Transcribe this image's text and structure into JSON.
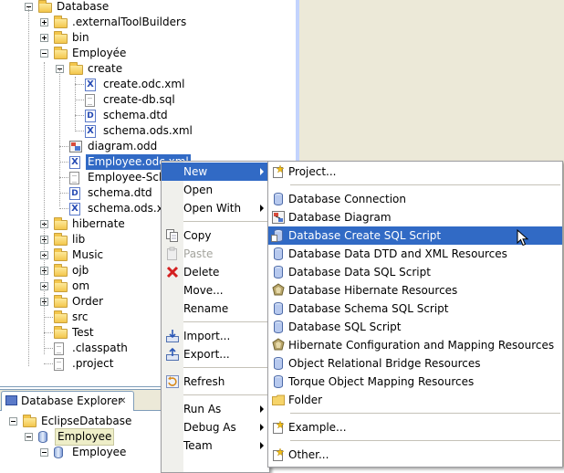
{
  "tree": [
    {
      "label": "Database",
      "type": "open-folder",
      "indent": 0,
      "expander": "minus"
    },
    {
      "label": ".externalToolBuilders",
      "type": "folder",
      "indent": 1,
      "expander": "plus"
    },
    {
      "label": "bin",
      "type": "folder",
      "indent": 1,
      "expander": "plus"
    },
    {
      "label": "Employée",
      "type": "open-folder",
      "indent": 1,
      "expander": "minus"
    },
    {
      "label": "create",
      "type": "open-folder",
      "indent": 2,
      "expander": "minus"
    },
    {
      "label": "create.odc.xml",
      "type": "xml",
      "indent": 3
    },
    {
      "label": "create-db.sql",
      "type": "file",
      "indent": 3
    },
    {
      "label": "schema.dtd",
      "type": "dtd",
      "indent": 3
    },
    {
      "label": "schema.ods.xml",
      "type": "xml",
      "indent": 3
    },
    {
      "label": "diagram.odd",
      "type": "diagram",
      "indent": 2
    },
    {
      "label": "Employee.odc.xml",
      "type": "xml",
      "indent": 2,
      "selected": true
    },
    {
      "label": "Employee-Schem",
      "type": "file",
      "indent": 2
    },
    {
      "label": "schema.dtd",
      "type": "dtd",
      "indent": 2
    },
    {
      "label": "schema.ods.xml",
      "type": "xml",
      "indent": 2
    },
    {
      "label": "hibernate",
      "type": "folder",
      "indent": 1,
      "expander": "plus"
    },
    {
      "label": "lib",
      "type": "folder",
      "indent": 1,
      "expander": "plus"
    },
    {
      "label": "Music",
      "type": "folder",
      "indent": 1,
      "expander": "plus"
    },
    {
      "label": "ojb",
      "type": "folder",
      "indent": 1,
      "expander": "plus"
    },
    {
      "label": "om",
      "type": "folder",
      "indent": 1,
      "expander": "plus"
    },
    {
      "label": "Order",
      "type": "folder",
      "indent": 1,
      "expander": "plus"
    },
    {
      "label": "src",
      "type": "folder",
      "indent": 1
    },
    {
      "label": "Test",
      "type": "folder",
      "indent": 1
    },
    {
      "label": ".classpath",
      "type": "file",
      "indent": 1
    },
    {
      "label": ".project",
      "type": "file",
      "indent": 1
    }
  ],
  "explorer": {
    "tab_label": "Database Explorer",
    "close_glyph": "✕",
    "items": [
      {
        "label": "EclipseDatabase",
        "type": "folder",
        "indent": 0,
        "expander": "minus"
      },
      {
        "label": "Employee",
        "type": "db",
        "indent": 1,
        "expander": "minus",
        "highlight": true
      },
      {
        "label": "Employee",
        "type": "db",
        "indent": 2,
        "expander": "minus"
      }
    ]
  },
  "context_menu": [
    {
      "label": "New",
      "submenu": true,
      "selected": true
    },
    {
      "label": "Open"
    },
    {
      "label": "Open With",
      "submenu": true
    },
    {
      "separator": true
    },
    {
      "label": "Copy",
      "icon": "copy-icon"
    },
    {
      "label": "Paste",
      "icon": "paste-icon",
      "disabled": true
    },
    {
      "label": "Delete",
      "icon": "delete-icon"
    },
    {
      "label": "Move..."
    },
    {
      "label": "Rename"
    },
    {
      "separator": true
    },
    {
      "label": "Import...",
      "icon": "import-icon"
    },
    {
      "label": "Export...",
      "icon": "export-icon"
    },
    {
      "separator": true
    },
    {
      "label": "Refresh",
      "icon": "refresh-icon"
    },
    {
      "separator": true
    },
    {
      "label": "Run As",
      "submenu": true
    },
    {
      "label": "Debug As",
      "submenu": true
    },
    {
      "label": "Team",
      "submenu": true
    }
  ],
  "new_submenu": [
    {
      "label": "Project...",
      "icon": "new-project-icon"
    },
    {
      "separator": true
    },
    {
      "label": "Database Connection",
      "icon": "db-icon"
    },
    {
      "label": "Database Diagram",
      "icon": "diagram-icon"
    },
    {
      "label": "Database Create SQL Script",
      "icon": "db-script-icon",
      "selected": true
    },
    {
      "label": "Database Data DTD and XML Resources",
      "icon": "db-icon"
    },
    {
      "label": "Database Data SQL Script",
      "icon": "db-icon"
    },
    {
      "label": "Database Hibernate Resources",
      "icon": "hibernate-icon"
    },
    {
      "label": "Database Schema SQL Script",
      "icon": "db-icon"
    },
    {
      "label": "Database SQL Script",
      "icon": "db-icon"
    },
    {
      "label": "Hibernate Configuration and Mapping Resources",
      "icon": "hibernate-icon"
    },
    {
      "label": "Object Relational Bridge Resources",
      "icon": "db-icon"
    },
    {
      "label": "Torque Object Mapping Resources",
      "icon": "db-icon"
    },
    {
      "label": "Folder",
      "icon": "folder-icon"
    },
    {
      "separator": true
    },
    {
      "label": "Example...",
      "icon": "new-example-icon"
    },
    {
      "separator": true
    },
    {
      "label": "Other...",
      "icon": "new-other-icon"
    }
  ],
  "colors": {
    "selection": "#316ac5",
    "editor_bg": "#ece9d8",
    "panel_border": "#7f9db9"
  }
}
